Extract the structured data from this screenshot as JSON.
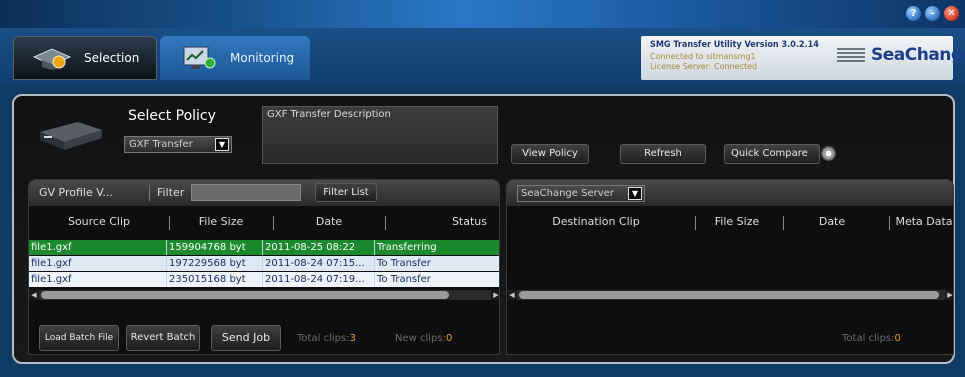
{
  "window": {
    "help_glyph": "?",
    "close_glyph": "✕"
  },
  "tabs": [
    {
      "label": "Selection",
      "icon": "graduation-cap-icon"
    },
    {
      "label": "Monitoring",
      "icon": "monitor-icon"
    }
  ],
  "brand": {
    "title": "SMG Transfer Utility Version 3.0.2.14",
    "connected": "Connected to  sitmansmg1",
    "license": "License Server: Connected",
    "logo": "SeaChange"
  },
  "policy": {
    "label": "Select Policy",
    "selected": "GXF Transfer",
    "description_label": "GXF Transfer Description",
    "view_label": "View Policy",
    "refresh_label": "Refresh",
    "compare_label": "Quick Compare"
  },
  "left_panel": {
    "title": "GV Profile V...",
    "filter_label": "Filter",
    "filter_value": "",
    "filter_button": "Filter List",
    "columns": [
      "Source Clip",
      "File Size",
      "Date",
      "Status"
    ],
    "rows": [
      {
        "clip": "file1.gxf",
        "size": "159904768 byt",
        "date": "2011-08-25 08:22",
        "status": "Transferring"
      },
      {
        "clip": "file1.gxf",
        "size": "197229568 byt",
        "date": "2011-08-24 07:15...",
        "status": "To Transfer"
      },
      {
        "clip": "file1.gxf",
        "size": "235015168 byt",
        "date": "2011-08-24 07:19...",
        "status": "To Transfer"
      }
    ],
    "load_label": "Load Batch File",
    "revert_label": "Revert Batch",
    "send_label": "Send Job",
    "total_label": "Total clips:",
    "total_value": "3",
    "new_label": "New clips:",
    "new_value": "0"
  },
  "right_panel": {
    "server": "SeaChange Server",
    "columns": [
      "Destination Clip",
      "File Size",
      "Date",
      "Meta Data"
    ],
    "total_label": "Total clips:",
    "total_value": "0"
  }
}
